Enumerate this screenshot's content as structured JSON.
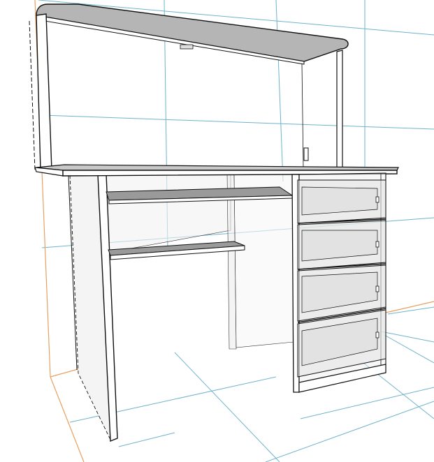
{
  "viewport": {
    "background": "#ffffff",
    "grid_color": "#6fb3cc",
    "guide_color": "#e8a060",
    "edge_color": "#111111",
    "shelf_fill": "#9a9a9a",
    "top_fill": "#c8c8c8",
    "glass_fill": "#e4e4e4"
  },
  "model": {
    "parts": [
      {
        "name": "upper-shelf"
      },
      {
        "name": "left-upright"
      },
      {
        "name": "right-upright"
      },
      {
        "name": "desktop"
      },
      {
        "name": "left-leg-panel"
      },
      {
        "name": "keyboard-tray"
      },
      {
        "name": "lower-shelf"
      },
      {
        "name": "middle-partition"
      },
      {
        "name": "drawer-pedestal"
      },
      {
        "name": "drawer-1"
      },
      {
        "name": "drawer-2"
      },
      {
        "name": "drawer-3"
      },
      {
        "name": "drawer-4"
      }
    ]
  }
}
